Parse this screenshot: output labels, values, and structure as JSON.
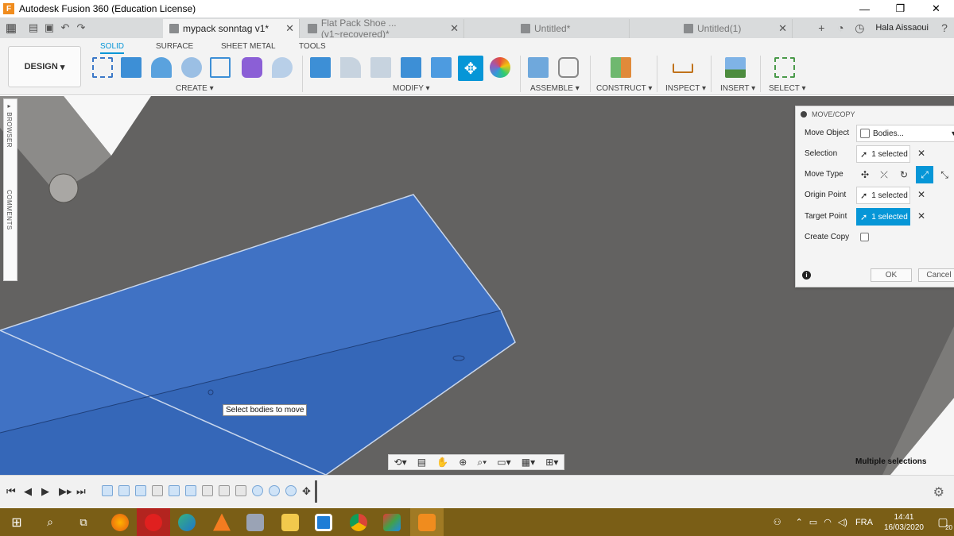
{
  "window": {
    "title": "Autodesk Fusion 360 (Education License)",
    "app_icon_letter": "F",
    "controls": [
      "—",
      "❐",
      "✕"
    ]
  },
  "tabs": [
    {
      "label": "mypack sonntag v1*",
      "active": true
    },
    {
      "label": "Flat Pack Shoe ...(v1~recovered)*",
      "active": false
    },
    {
      "label": "Untitled*",
      "active": false
    },
    {
      "label": "Untitled(1)",
      "active": false
    }
  ],
  "user": {
    "name": "Hala Aissaoui"
  },
  "ribbon": {
    "workspace": "DESIGN",
    "tabs": [
      "SOLID",
      "SURFACE",
      "SHEET METAL",
      "TOOLS"
    ],
    "groups": [
      "CREATE",
      "MODIFY",
      "ASSEMBLE",
      "CONSTRUCT",
      "INSPECT",
      "INSERT",
      "SELECT"
    ]
  },
  "side_panel": {
    "browser": "BROWSER",
    "comments": "COMMENTS"
  },
  "viewport": {
    "tooltip": "Select bodies to move",
    "status": "Multiple selections"
  },
  "dialog": {
    "title": "MOVE/COPY",
    "move_object_label": "Move Object",
    "move_object_value": "Bodies...",
    "selection_label": "Selection",
    "selection_value": "1 selected",
    "move_type_label": "Move Type",
    "origin_point_label": "Origin Point",
    "origin_point_value": "1 selected",
    "target_point_label": "Target Point",
    "target_point_value": "1 selected",
    "create_copy_label": "Create Copy",
    "create_copy_checked": false,
    "ok": "OK",
    "cancel": "Cancel"
  },
  "taskbar": {
    "language": "FRA",
    "time": "14:41",
    "date": "16/03/2020",
    "notification_count": "20"
  },
  "colors": {
    "accent": "#0696d7",
    "body_blue": "#3b72c5",
    "viewport_bg": "#636261",
    "taskbar": "#7a5e16"
  }
}
